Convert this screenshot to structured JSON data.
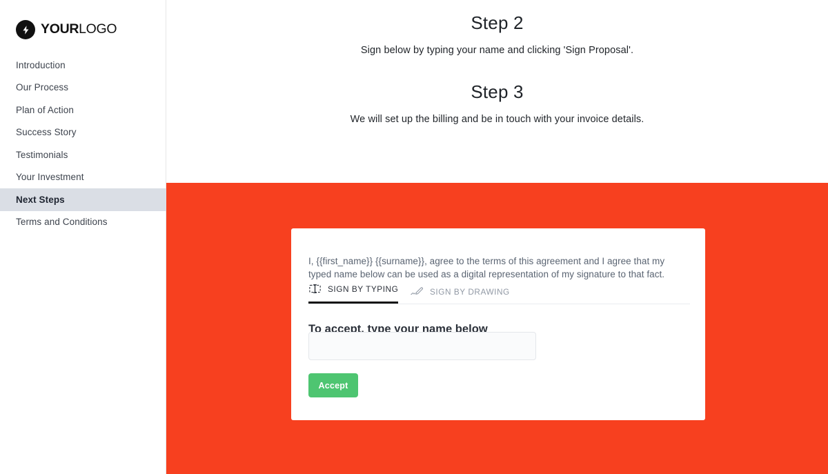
{
  "brand": {
    "logo_mark_icon": "lightning-bolt-icon",
    "logo_text_strong": "YOUR",
    "logo_text_light": "LOGO",
    "logo_color": "#111111"
  },
  "sidebar": {
    "items": [
      {
        "label": "Introduction",
        "active": false
      },
      {
        "label": "Our Process",
        "active": false
      },
      {
        "label": "Plan of Action",
        "active": false
      },
      {
        "label": "Success Story",
        "active": false
      },
      {
        "label": "Testimonials",
        "active": false
      },
      {
        "label": "Your Investment",
        "active": false
      },
      {
        "label": "Next Steps",
        "active": true
      },
      {
        "label": "Terms and Conditions",
        "active": false
      }
    ],
    "active_background": "#dadee5"
  },
  "main": {
    "step2": {
      "title": "Step 2",
      "subtitle": "Sign below by typing your name and clicking 'Sign Proposal'."
    },
    "step3": {
      "title": "Step 3",
      "subtitle": "We will set up the billing and be in touch with your invoice details."
    },
    "band_color": "#f7401f"
  },
  "signature_card": {
    "agreement_text": "I, {{first_name}} {{surname}}, agree to the terms of this agreement and I agree that my typed name below can be used as a digital representation of my signature to that fact.",
    "tabs": [
      {
        "label": "SIGN BY TYPING",
        "icon": "text-input-icon",
        "active": true
      },
      {
        "label": "SIGN BY DRAWING",
        "icon": "signature-pen-icon",
        "active": false
      }
    ],
    "accept_heading": "To accept, type your name below",
    "name_input": {
      "value": "",
      "placeholder": ""
    },
    "accept_button": {
      "label": "Accept",
      "color": "#4ec571"
    }
  }
}
